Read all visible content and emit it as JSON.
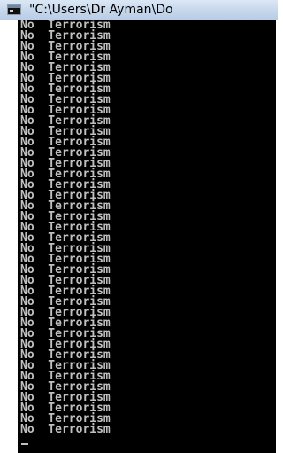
{
  "window": {
    "title": "\"C:\\Users\\Dr Ayman\\Do",
    "icon": "console-icon"
  },
  "console": {
    "lines": [
      "No  Terrorism",
      "No  Terrorism",
      "No  Terrorism",
      "No  Terrorism",
      "No  Terrorism",
      "No  Terrorism",
      "No  Terrorism",
      "No  Terrorism",
      "No  Terrorism",
      "No  Terrorism",
      "No  Terrorism",
      "No  Terrorism",
      "No  Terrorism",
      "No  Terrorism",
      "No  Terrorism",
      "No  Terrorism",
      "No  Terrorism",
      "No  Terrorism",
      "No  Terrorism",
      "No  Terrorism",
      "No  Terrorism",
      "No  Terrorism",
      "No  Terrorism",
      "No  Terrorism",
      "No  Terrorism",
      "No  Terrorism",
      "No  Terrorism",
      "No  Terrorism",
      "No  Terrorism",
      "No  Terrorism",
      "No  Terrorism",
      "No  Terrorism",
      "No  Terrorism",
      "No  Terrorism",
      "No  Terrorism",
      "No  Terrorism",
      "No  Terrorism",
      "No  Terrorism",
      "No  Terrorism"
    ],
    "text_color": "#c0c0c0",
    "background_color": "#000000"
  }
}
